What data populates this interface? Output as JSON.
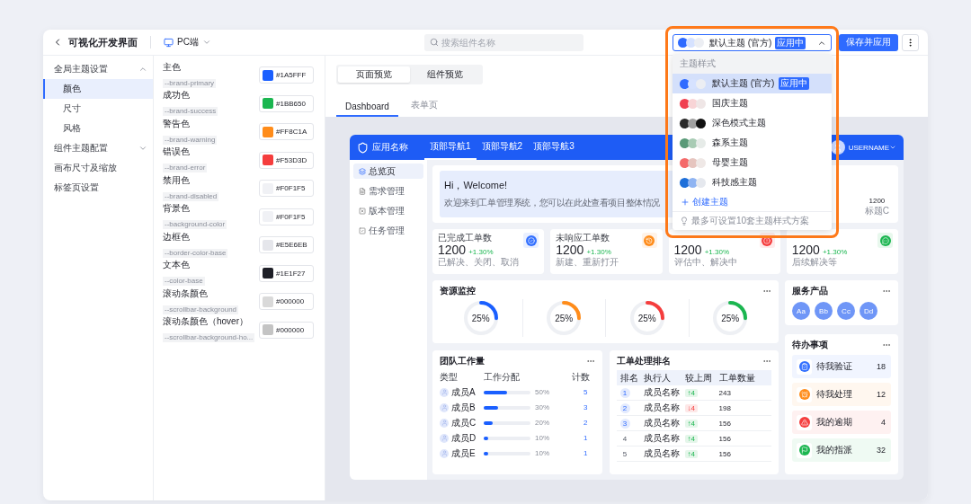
{
  "header": {
    "title": "可视化开发界面",
    "platform": "PC端"
  },
  "search": {
    "placeholder": "搜索组件名称"
  },
  "theme_select": {
    "value": "默认主题 (官方)",
    "badge": "应用中",
    "expanded": true,
    "swatches": [
      {
        "color": "#2f6bff"
      },
      {
        "color": "#d6e2ff"
      },
      {
        "color": "#eceef3"
      }
    ]
  },
  "save_button": "保存并应用",
  "nav": [
    {
      "label": "全局主题设置",
      "kind": "group",
      "expanded": true,
      "children": [
        {
          "label": "颜色",
          "selected": true
        },
        {
          "label": "尺寸",
          "selected": false
        },
        {
          "label": "风格",
          "selected": false
        }
      ]
    },
    {
      "label": "组件主题配置",
      "kind": "group",
      "expanded": false
    },
    {
      "label": "画布尺寸及缩放",
      "kind": "link"
    },
    {
      "label": "标签页设置",
      "kind": "link"
    }
  ],
  "colors": [
    {
      "name": "主色",
      "token": "--brand-primary",
      "value": "#1A5FFF",
      "color": "#1a5fff"
    },
    {
      "name": "成功色",
      "token": "--brand-success",
      "value": "#1BB650",
      "color": "#1bb650"
    },
    {
      "name": "警告色",
      "token": "--brand-warning",
      "value": "#FF8C1A",
      "color": "#ff8c1a"
    },
    {
      "name": "错误色",
      "token": "--brand-error",
      "value": "#F53D3D",
      "color": "#f53d3d"
    },
    {
      "name": "禁用色",
      "token": "--brand-disabled",
      "value": "#F0F1F5",
      "color": "#f0f1f5"
    },
    {
      "name": "背景色",
      "token": "--background-color",
      "value": "#F0F1F5",
      "color": "#f0f1f5"
    },
    {
      "name": "边框色",
      "token": "--border-color-base",
      "value": "#E5E6EB",
      "color": "#e5e6eb"
    },
    {
      "name": "文本色",
      "token": "--color-base",
      "value": "#1E1F27",
      "color": "#1e1f27"
    },
    {
      "name": "滚动条颜色",
      "token": "--scrollbar-background",
      "value": "#000000",
      "color": "#d9d9d9"
    },
    {
      "name": "滚动条颜色（hover）",
      "token": "--scrollbar-background-ho...",
      "value": "#000000",
      "color": "#c4c4c4"
    }
  ],
  "preview_modes": [
    {
      "label": "页面预览",
      "selected": true
    },
    {
      "label": "组件预览",
      "selected": false
    }
  ],
  "page_tabs": [
    {
      "label": "Dashboard",
      "selected": true
    },
    {
      "label": "表单页",
      "selected": false
    }
  ],
  "app": {
    "name": "应用名称",
    "user": "USERNAME",
    "nav": [
      {
        "label": "顶部导航1",
        "selected": true
      },
      {
        "label": "顶部导航2",
        "selected": false
      },
      {
        "label": "顶部导航3",
        "selected": false
      }
    ],
    "sidebar": [
      {
        "label": "总览页",
        "selected": true
      },
      {
        "label": "需求管理",
        "selected": false
      },
      {
        "label": "版本管理",
        "selected": false
      },
      {
        "label": "任务管理",
        "selected": false
      }
    ],
    "welcome": {
      "title": "Hi，Welcome!",
      "text": "欢迎来到工单管理系统，您可以在此处查看项目整体情况"
    },
    "summary": {
      "value": "1200",
      "label": "标题C"
    },
    "stats": [
      {
        "title": "已完成工单数",
        "value": "1200",
        "change": "+1.30%",
        "note": "已解决、关闭、取消",
        "color": "#3370ff"
      },
      {
        "title": "未响应工单数",
        "value": "1200",
        "change": "+1.30%",
        "note": "新建、重新打开",
        "color": "#ff8c1a"
      },
      {
        "value": "1200",
        "change": "+1.30%",
        "note": "评估中、解决中",
        "color": "#f53d3d"
      },
      {
        "value": "1200",
        "change": "+1.30%",
        "note": "后续解决等",
        "color": "#1bb650"
      }
    ],
    "resource": {
      "title": "资源监控",
      "gauges": [
        {
          "label": "25%",
          "level": 0.25,
          "color": "#1a5fff"
        },
        {
          "label": "25%",
          "level": 0.25,
          "color": "#ff8c1a"
        },
        {
          "label": "25%",
          "level": 0.25,
          "color": "#f53d3d"
        },
        {
          "label": "25%",
          "level": 0.25,
          "color": "#1bb650"
        }
      ]
    },
    "services": {
      "title": "服务产品",
      "items": [
        "Aa",
        "Bb",
        "Cc",
        "Dd"
      ]
    },
    "todos": {
      "title": "待办事项",
      "items": [
        {
          "label": "待我验证",
          "count": "18",
          "color": "#3370ff"
        },
        {
          "label": "待我处理",
          "count": "12",
          "color": "#ff8c1a"
        },
        {
          "label": "我的逾期",
          "count": "4",
          "color": "#f53d3d"
        },
        {
          "label": "我的指派",
          "count": "32",
          "color": "#1bb650"
        }
      ]
    },
    "team": {
      "title": "团队工作量",
      "columns": [
        "类型",
        "工作分配",
        "计数"
      ],
      "rows": [
        {
          "name": "成员A",
          "level": 0.5,
          "percent": "50%",
          "count": "5"
        },
        {
          "name": "成员B",
          "level": 0.3,
          "percent": "30%",
          "count": "3"
        },
        {
          "name": "成员C",
          "level": 0.2,
          "percent": "20%",
          "count": "2"
        },
        {
          "name": "成员D",
          "level": 0.1,
          "percent": "10%",
          "count": "1"
        },
        {
          "name": "成员E",
          "level": 0.1,
          "percent": "10%",
          "count": "1"
        }
      ]
    },
    "ranking": {
      "title": "工单处理排名",
      "columns": [
        "排名",
        "执行人",
        "较上周",
        "工单数量"
      ],
      "rows": [
        {
          "rank": "1",
          "highlighted": true,
          "name": "成员名称",
          "change": "↑4",
          "rising": true,
          "count": "243"
        },
        {
          "rank": "2",
          "highlighted": true,
          "name": "成员名称",
          "change": "↓4",
          "rising": false,
          "count": "198"
        },
        {
          "rank": "3",
          "highlighted": true,
          "name": "成员名称",
          "change": "↑4",
          "rising": true,
          "count": "156"
        },
        {
          "rank": "4",
          "highlighted": false,
          "name": "成员名称",
          "change": "↑4",
          "rising": true,
          "count": "156"
        },
        {
          "rank": "5",
          "highlighted": false,
          "name": "成员名称",
          "change": "↑4",
          "rising": true,
          "count": "156"
        }
      ]
    }
  },
  "theme_menu": {
    "heading": "主题样式",
    "create": "创建主题",
    "hint": "最多可设置10套主题样式方案",
    "items": [
      {
        "label": "默认主题 (官方)",
        "badge": "应用中",
        "selected": true,
        "swatches": [
          {
            "color": "#2f6bff"
          },
          {
            "color": "#d6e2ff"
          },
          {
            "color": "#eceef3"
          }
        ]
      },
      {
        "label": "国庆主题",
        "selected": false,
        "swatches": [
          {
            "color": "#f04050"
          },
          {
            "color": "#f8d4d6"
          },
          {
            "color": "#efe6e6"
          }
        ]
      },
      {
        "label": "深色模式主题",
        "selected": false,
        "swatches": [
          {
            "color": "#2a2a2a"
          },
          {
            "color": "#a0a0a0"
          },
          {
            "color": "#111111"
          }
        ]
      },
      {
        "label": "森系主题",
        "selected": false,
        "swatches": [
          {
            "color": "#5a9a78"
          },
          {
            "color": "#a8cbb4"
          },
          {
            "color": "#e6ebe8"
          }
        ]
      },
      {
        "label": "母婴主题",
        "selected": false,
        "swatches": [
          {
            "color": "#f46a6a"
          },
          {
            "color": "#e6c5bf"
          },
          {
            "color": "#efe8e6"
          }
        ]
      },
      {
        "label": "科技感主题",
        "selected": false,
        "swatches": [
          {
            "color": "#1e6fd9"
          },
          {
            "color": "#8fb4f2"
          },
          {
            "color": "#e5e8ee"
          }
        ]
      }
    ]
  }
}
